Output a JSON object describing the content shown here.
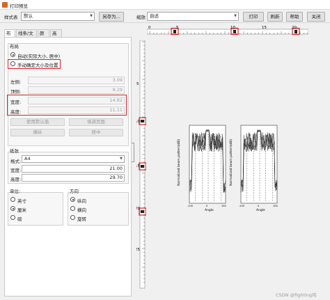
{
  "window": {
    "title": "打印预览"
  },
  "toolbar": {
    "style_label": "样式表",
    "style_value": "默认",
    "save_as": "另存为...",
    "zoom_label": "缩放",
    "zoom_value": "自适",
    "print": "打印",
    "refresh": "刷新",
    "help": "帮助",
    "close": "关闭"
  },
  "tabs": [
    "布局",
    "线条/文本",
    "颜色",
    "高级"
  ],
  "layout": {
    "group_title": "布局",
    "auto_option": "自动(实际大小, 居中)",
    "manual_option": "手动确定大小及位置",
    "left_label": "左侧:",
    "left_value": "3.09",
    "top_label": "顶侧:",
    "top_value": "9.29",
    "width_label": "宽度:",
    "width_value": "14.82",
    "height_label": "高度:",
    "height_value": "11.11",
    "use_default": "使用默认值",
    "fill_page": "填满页面",
    "fix_aspect": "横纵",
    "center": "居中"
  },
  "paper": {
    "group_title": "纸张",
    "format_label": "格式:",
    "format_value": "A4",
    "width_label": "宽度:",
    "width_value": "21.00",
    "height_label": "高度:",
    "height_value": "29.70"
  },
  "units": {
    "title": "单位:",
    "options": [
      "英寸",
      "厘米",
      "磅"
    ],
    "selected": 1
  },
  "orientation": {
    "title": "方向",
    "options": [
      "纵向",
      "横向",
      "旋转"
    ],
    "selected": 0
  },
  "ruler_top": {
    "labels": [
      "0",
      "5",
      "10",
      "15",
      "20"
    ]
  },
  "ruler_left": {
    "labels": [
      "5",
      "10",
      "15",
      "20",
      "25"
    ]
  },
  "preview": {
    "left_plot": {
      "ylabel": "Normalized beam pattern(dB)",
      "xlabel": "Angle",
      "xticks": [
        "-100",
        "0",
        "100"
      ],
      "yticks": [
        "0",
        "-10",
        "-20",
        "-30",
        "-40",
        "-50"
      ]
    },
    "right_plot": {
      "ylabel": "Normalized beam pattern(dB)",
      "xlabel": "Angle",
      "xticks": [
        "-100",
        "0",
        "100"
      ],
      "yticks": [
        "0",
        "-10",
        "-20",
        "-30",
        "-40",
        "-50"
      ]
    }
  },
  "watermark": "CSDN @fighting鸡"
}
